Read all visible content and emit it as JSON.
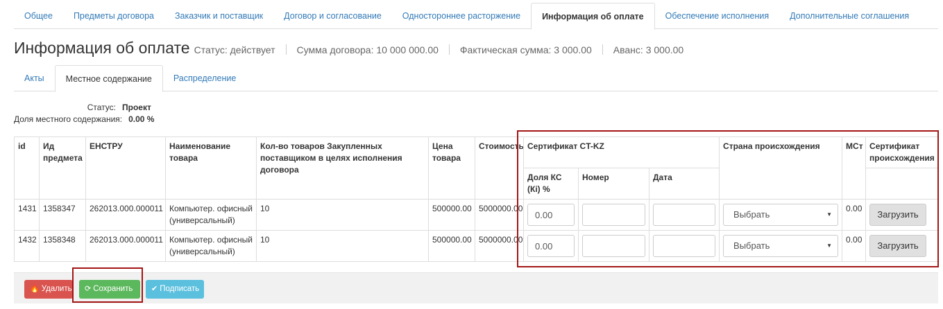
{
  "top_tabs": [
    {
      "label": "Общее"
    },
    {
      "label": "Предметы договора"
    },
    {
      "label": "Заказчик и поставщик"
    },
    {
      "label": "Договор и согласование"
    },
    {
      "label": "Одностороннее расторжение"
    },
    {
      "label": "Информация об оплате",
      "active": true
    },
    {
      "label": "Обеспечение исполнения"
    },
    {
      "label": "Дополнительные соглашения"
    }
  ],
  "header": {
    "title": "Информация об оплате",
    "status": "Статус: действует",
    "contract_sum": "Сумма договора: 10 000 000.00",
    "actual_sum": "Фактическая сумма: 3 000.00",
    "advance": "Аванс: 3 000.00"
  },
  "sub_tabs": [
    {
      "label": "Акты"
    },
    {
      "label": "Местное содержание",
      "active": true
    },
    {
      "label": "Распределение"
    }
  ],
  "status_block": {
    "status_label": "Статус:",
    "status_value": "Проект",
    "share_label": "Доля местного содержания:",
    "share_value": "0.00 %"
  },
  "table": {
    "headers": {
      "id": "id",
      "item_id": "Ид предмета",
      "enstru": "ЕНСТРУ",
      "name": "Наименование товара",
      "qty": "Кол-во товаров Закупленных поставщиком в целях исполнения договора",
      "price": "Цена товара",
      "cost": "Стоимость (СТі)",
      "cert_ct_kz": "Сертификат CT-KZ",
      "cert_share": "Доля КС (Кі) %",
      "cert_number": "Номер",
      "cert_date": "Дата",
      "country": "Страна происхождения",
      "mst": "МСт",
      "origin_cert": "Сертификат происхождения"
    },
    "rows": [
      {
        "id": "1431",
        "item_id": "1358347",
        "enstru": "262013.000.000011",
        "name": "Компьютер. офисный (универсальный)",
        "qty": "10",
        "price": "500000.00",
        "cost": "5000000.00",
        "share_value": "0.00",
        "number_value": "",
        "date_value": "",
        "country": "Выбрать",
        "mst": "0.00",
        "upload": "Загрузить"
      },
      {
        "id": "1432",
        "item_id": "1358348",
        "enstru": "262013.000.000011",
        "name": "Компьютер. офисный (универсальный)",
        "qty": "10",
        "price": "500000.00",
        "cost": "5000000.00",
        "share_value": "0.00",
        "number_value": "",
        "date_value": "",
        "country": "Выбрать",
        "mst": "0.00",
        "upload": "Загрузить"
      }
    ]
  },
  "footer": {
    "delete_label": "Удалить",
    "save_label": "Сохранить",
    "sign_label": "Подписать"
  },
  "icons": {
    "delete": "fire-icon",
    "save": "refresh-icon",
    "sign": "check-icon",
    "select": "caret-down-icon"
  },
  "colors": {
    "link": "#337ab7",
    "danger": "#d9534f",
    "success": "#5cb85c",
    "info": "#5bc0de",
    "highlight": "#a31515"
  }
}
